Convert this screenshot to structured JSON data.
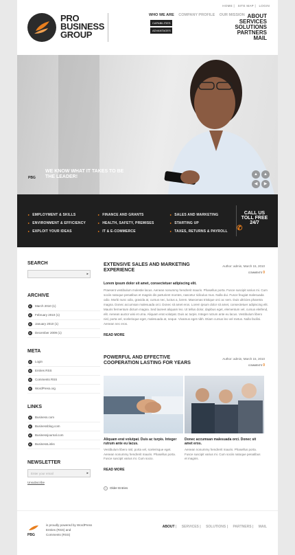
{
  "brand": {
    "name_line1": "PRO",
    "name_line2": "BUSINESS",
    "name_line3": "GROUP",
    "short": "PBG",
    "accent": "#e87e1d"
  },
  "top_links": [
    "HOME",
    "SITE MAP",
    "LOGIN"
  ],
  "nav": {
    "items": [
      "WHO WE ARE",
      "COMPANY PROFILE",
      "OUR MISSION"
    ],
    "sub": [
      "CAPABILITIES",
      "ADVANTAGES"
    ],
    "right": [
      "ABOUT",
      "SERVICES",
      "SOLUTIONS",
      "PARTNERS",
      "MAIL"
    ]
  },
  "hero": {
    "slogan": "WE KNOW WHAT IT TAKES TO BE THE LEADER!",
    "arrows": [
      "▲",
      "▲",
      "◀",
      "▶"
    ]
  },
  "band": {
    "col1": [
      "EMPLOYMENT & SKILLS",
      "ENVIRONMENT & EFFICIENCY",
      "EXPLOIT YOUR IDEAS"
    ],
    "col2": [
      "FINANCE AND GRANTS",
      "HEALTH, SAFETY, PREMISES",
      "IT & E-COMMERCE"
    ],
    "col3": [
      "SALES AND MARKETING",
      "STARTING UP",
      "TAXES, RETURNS & PAYROLL"
    ],
    "call": [
      "CALL US",
      "TOLL FREE",
      "24/7"
    ]
  },
  "sidebar": {
    "search_title": "SEARCH",
    "archive_title": "ARCHIVE",
    "archive": [
      "March 2010 (1)",
      "February 2010 (1)",
      "January 2010 (1)",
      "December 2009 (1)"
    ],
    "meta_title": "META",
    "meta": [
      "Login",
      "Entries RSS",
      "Comments RSS",
      "WordPress.org"
    ],
    "links_title": "LINKS",
    "links": [
      "Business.com",
      "Businessblog.com",
      "Businessjournal.com",
      "BusinessLinks"
    ],
    "newsletter_title": "NEWSLETTER",
    "newsletter_placeholder": "Enter your email",
    "unsubscribe": "Unsubscribe"
  },
  "posts": [
    {
      "title": "EXTENSIVE SALES AND MARKETING EXPERIENCE",
      "meta": "Author: admin, March 15, 2010",
      "comments": "COMMENTS",
      "comments_count": "0",
      "lead": "Lorem ipsum dolor sit amet, consectetuer adipiscing elit.",
      "body": "Praesent vestibulum molestie lacus. Aenean nonummy hendrerit mauris. Phasellus porta. Fusce suscipit varius mi. Cum sociis natoque penatibus et magnis dis parturient montes, nascetur ridiculus mus. Nulla dui. Fusce feugiat malesuada odio. Morbi nunc odio, gravida at, cursus nec, luctus a, lorem. Maecenas tristique orci ac sem. Duis ultricies pharetra magna. Donec accumsan malesuada orci. Donec sit amet eros. Lorem ipsum dolor sit amet, consectetuer adipiscing elit. Mauris fermentum dictum magna. Sed laoreet aliquam leo. Ut tellus dolor, dapibus eget, elementum vel, cursus eleifend, elit. Aenean auctor wisi et urna. Aliquam erat volutpat. Duis ac turpis. Integer rutrum ante eu lacus. Vestibulum libero nisl, porta vel, scelerisque eget, malesuada at, neque. Vivamus eget nibh. Etiam cursus leo vel metus. Nulla facilisi. Aenean nec eros.",
      "more": "READ MORE"
    },
    {
      "title": "POWERFUL AND EFFECTIVE COOPERATION LASTING FOR YEARS",
      "meta": "Author: admin, March 15, 2010",
      "comments": "COMMENTS",
      "comments_count": "0",
      "col1_title": "Aliquam erat volutpat. Duis ac turpis. Integer rutrum ante eu lacus.",
      "col1_body": "Vestibulum libero nisl, porta vel, scelerisque eget. Aenean nonummy hendrerit mauris. Phasellus porta. Fusce suscipit varius mi. Cum socio.",
      "col2_title": "Donec accumsan malesuada orci. Donec sit amet eros.",
      "col2_body": "Aenean nonummy hendrerit mauris. Phasellus porta. Fusce suscipit varius mi. Cum sociis natoque penatibus et magnis.",
      "more": "READ MORE"
    }
  ],
  "older": "Older Entries",
  "footer": {
    "logo": "PBG",
    "line1": "is proudly powered by WordPress",
    "line2": "Entries (RSS) and",
    "line3": "Comments (RSS)",
    "nav": [
      "ABOUT",
      "SERVICES",
      "SOLUTIONS",
      "PARTNERS",
      "MAIL"
    ]
  }
}
